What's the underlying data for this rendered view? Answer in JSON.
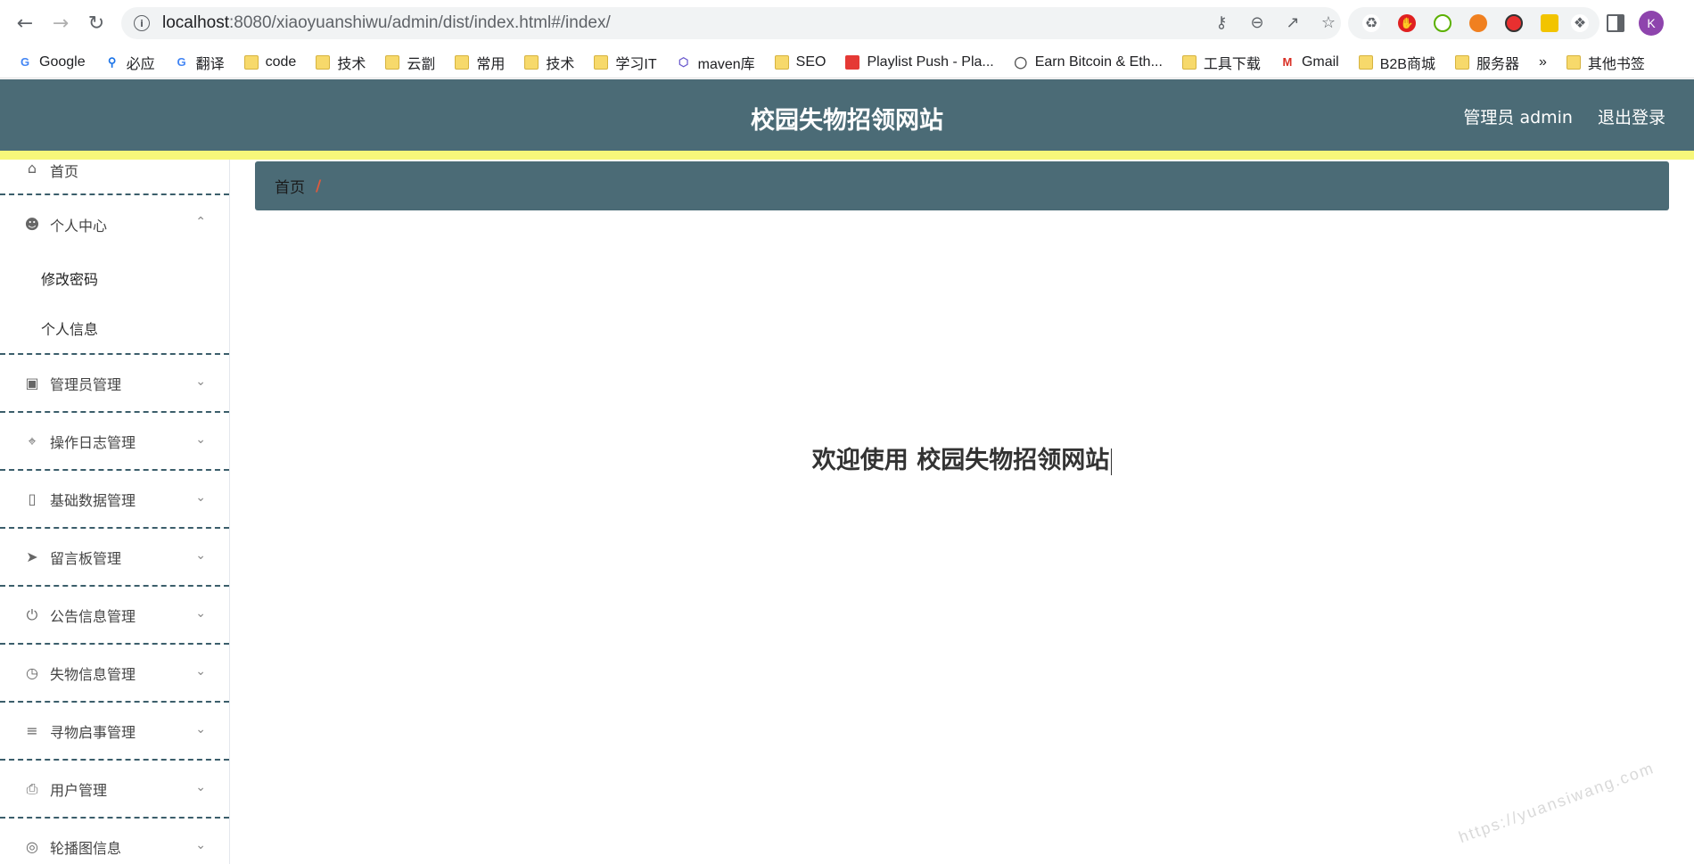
{
  "browser": {
    "url_host": "localhost",
    "url_path": ":8080/xiaoyuanshiwu/admin/dist/index.html#/index/",
    "avatar_letter": "K",
    "bookmarks": [
      {
        "label": "Google",
        "icon": "google-icon"
      },
      {
        "label": "必应",
        "icon": "bing-icon"
      },
      {
        "label": "翻译",
        "icon": "translate-icon"
      },
      {
        "label": "code",
        "icon": "folder-icon"
      },
      {
        "label": "技术",
        "icon": "folder-icon"
      },
      {
        "label": "云劏",
        "icon": "folder-icon"
      },
      {
        "label": "常用",
        "icon": "folder-icon"
      },
      {
        "label": "技术",
        "icon": "folder-icon"
      },
      {
        "label": "学习IT",
        "icon": "folder-icon"
      },
      {
        "label": "maven库",
        "icon": "hexagon-icon"
      },
      {
        "label": "SEO",
        "icon": "folder-icon"
      },
      {
        "label": "Playlist Push - Pla...",
        "icon": "playlist-icon"
      },
      {
        "label": "Earn Bitcoin & Eth...",
        "icon": "globe-icon"
      },
      {
        "label": "工具下载",
        "icon": "folder-icon"
      },
      {
        "label": "Gmail",
        "icon": "gmail-icon"
      },
      {
        "label": "B2B商城",
        "icon": "folder-icon"
      },
      {
        "label": "服务器",
        "icon": "folder-icon"
      }
    ],
    "bookmarks_overflow": "»",
    "other_bookmarks": "其他书签"
  },
  "header": {
    "title": "校园失物招领网站",
    "user_label": "管理员 admin",
    "logout_label": "退出登录"
  },
  "sidebar": {
    "home": {
      "label": "首页",
      "icon": "home-icon"
    },
    "personal_center": {
      "label": "个人中心",
      "icon": "user-icon",
      "children": [
        "修改密码",
        "个人信息"
      ]
    },
    "items": [
      {
        "label": "管理员管理",
        "icon": "briefcase-icon"
      },
      {
        "label": "操作日志管理",
        "icon": "crop-icon"
      },
      {
        "label": "基础数据管理",
        "icon": "mobile-icon"
      },
      {
        "label": "留言板管理",
        "icon": "send-icon"
      },
      {
        "label": "公告信息管理",
        "icon": "power-icon"
      },
      {
        "label": "失物信息管理",
        "icon": "clock-icon"
      },
      {
        "label": "寻物启事管理",
        "icon": "sliders-icon"
      },
      {
        "label": "用户管理",
        "icon": "printer-icon"
      },
      {
        "label": "轮播图信息",
        "icon": "lifebuoy-icon"
      }
    ]
  },
  "breadcrumb": {
    "home": "首页",
    "separator": "/"
  },
  "main": {
    "welcome": "欢迎使用 校园失物招领网站"
  },
  "watermark": "https://yuansiwang.com",
  "colors": {
    "header_bg": "#4b6b76",
    "accent_strip": "#f7f77a",
    "breadcrumb_separator": "#e05a3c"
  }
}
